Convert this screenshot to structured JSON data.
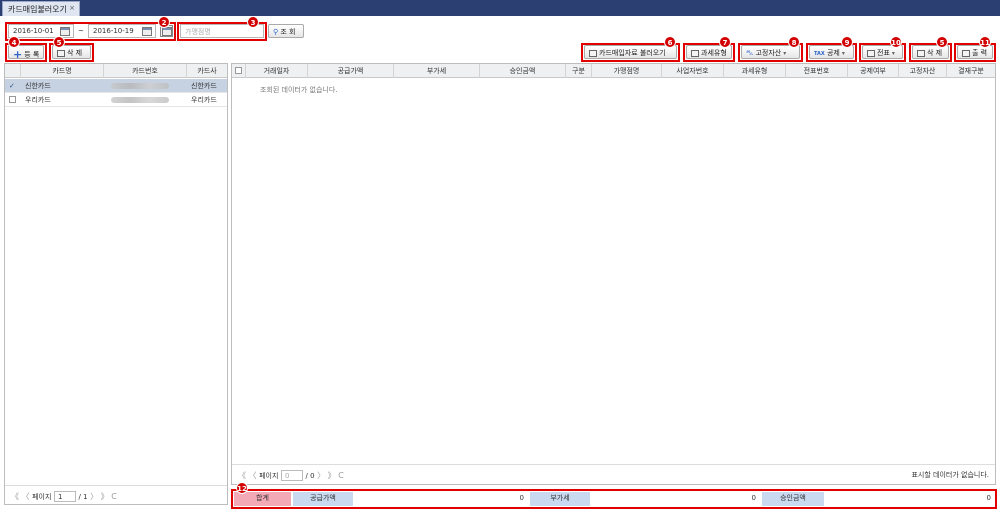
{
  "tab": {
    "title": "카드매입불러오기",
    "close": "×"
  },
  "toolbar": {
    "date_from": "2016-10-01",
    "separator": "~",
    "date_to": "2016-10-19",
    "merchant_placeholder": "가맹점명",
    "search_label": "조 회",
    "register_label": "등 록",
    "delete_label": "삭 제",
    "load_card_label": "카드매입자료 불러오기",
    "tax_type_label": "과세유형",
    "fixed_asset_label": "고정자산",
    "tax_icon_text": "TAX",
    "deduction_label": "공제",
    "slip_label": "전표",
    "delete_right_label": "삭 제",
    "print_label": "출 력"
  },
  "badges": [
    "2",
    "3",
    "4",
    "5",
    "6",
    "7",
    "8",
    "9",
    "10",
    "5",
    "11",
    "12"
  ],
  "card_grid": {
    "headers": [
      "카드명",
      "카드번호",
      "카드사"
    ],
    "rows": [
      {
        "name": "신한카드",
        "issuer": "신한카드",
        "checked": true
      },
      {
        "name": "우리카드",
        "issuer": "우리카드",
        "checked": false
      }
    ],
    "check_mark": "✓"
  },
  "main_grid": {
    "headers": [
      "거래일자",
      "공급가액",
      "부가세",
      "승인금액",
      "구분",
      "가맹점명",
      "사업자번호",
      "과세유형",
      "전표번호",
      "공제여부",
      "고정자산",
      "결재구분"
    ],
    "empty_message": "조회된 데이터가 없습니다."
  },
  "left_pager": {
    "label": "페이지",
    "page": "1",
    "total": "/ 1"
  },
  "right_pager": {
    "label": "페이지",
    "page": "0",
    "total": "/ 0",
    "no_data": "표시할 데이터가 없습니다."
  },
  "pager_icons": {
    "first": "《",
    "prev": "〈",
    "next": "〉",
    "last": "》",
    "refresh": "C"
  },
  "summary": {
    "total_label": "합계",
    "supply_label": "공급가액",
    "supply_value": "0",
    "vat_label": "부가세",
    "vat_value": "0",
    "approval_label": "승인금액",
    "approval_value": "0"
  },
  "colors": {
    "accent": "#2c3f73",
    "highlight": "#e00000",
    "total_bg": "#f4a9b6",
    "label_bg": "#c9d9f0"
  }
}
